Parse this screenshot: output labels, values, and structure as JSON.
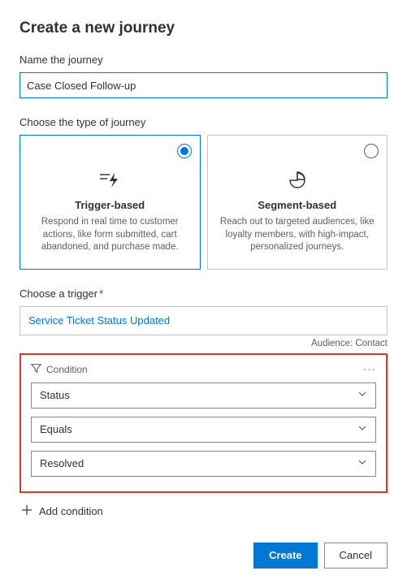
{
  "header": {
    "title": "Create a new journey"
  },
  "name_section": {
    "label": "Name the journey",
    "value": "Case Closed Follow-up"
  },
  "type_section": {
    "label": "Choose the type of journey",
    "cards": [
      {
        "title": "Trigger-based",
        "desc": "Respond in real time to customer actions, like form submitted, cart abandoned, and purchase made."
      },
      {
        "title": "Segment-based",
        "desc": "Reach out to targeted audiences, like loyalty members, with high-impact, personalized journeys."
      }
    ]
  },
  "trigger_section": {
    "label": "Choose a trigger",
    "value": "Service Ticket Status Updated",
    "audience_label": "Audience: Contact"
  },
  "condition_section": {
    "header": "Condition",
    "field": "Status",
    "operator": "Equals",
    "match_value": "Resolved"
  },
  "add_condition_label": "Add condition",
  "footer": {
    "create": "Create",
    "cancel": "Cancel"
  }
}
